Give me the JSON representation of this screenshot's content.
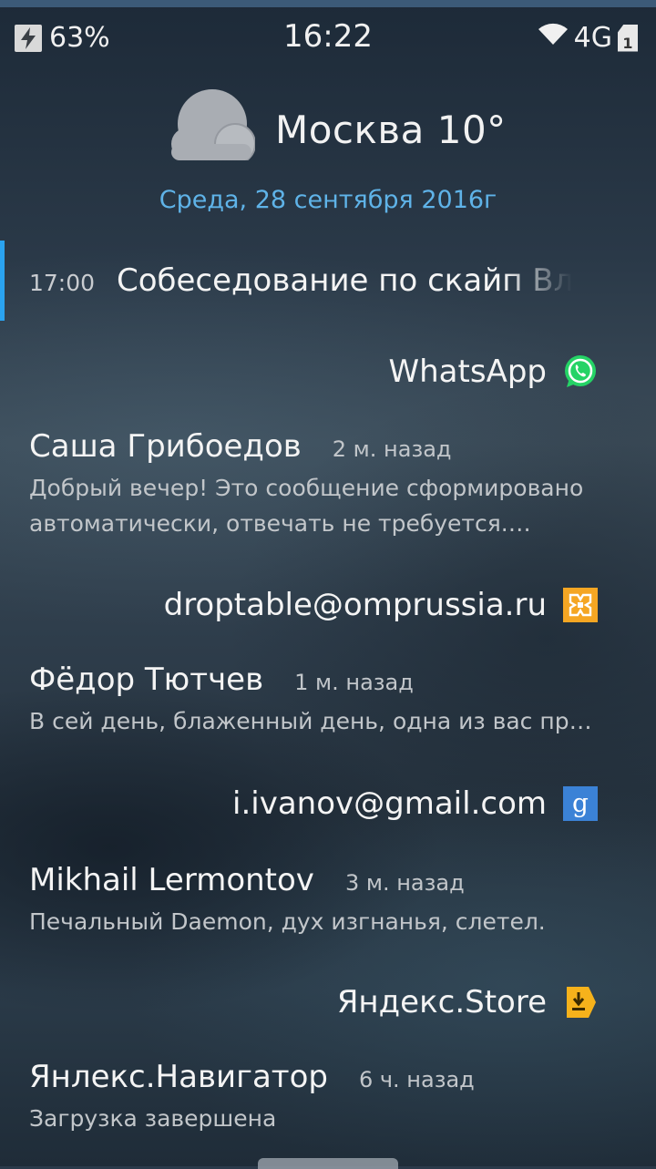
{
  "status_bar": {
    "battery": "63%",
    "time": "16:22",
    "network": "4G",
    "sim": "1"
  },
  "weather": {
    "icon": "cloud-icon",
    "text": "Москва 10°"
  },
  "date": "Среда, 28 сентября 2016г",
  "calendar_event": {
    "time": "17:00",
    "title": "Собеседование по скайп Вла"
  },
  "groups": [
    {
      "account": "WhatsApp",
      "icon": "whatsapp-icon",
      "color": "#25d366",
      "notification": {
        "sender": "Саша Грибоедов",
        "ago": "2 м. назад",
        "message": "Добрый вечер! Это сообщение сформировано автоматически, отвечать не требуется. Тестовое сообщение"
      }
    },
    {
      "account": "droptable@omprussia.ru",
      "icon": "mail-exchange-icon",
      "color": "#f5a623",
      "notification": {
        "sender": "Фёдор Тютчев",
        "ago": "1 м. назад",
        "message": "В сей день, блаженный день, одна из вас прияла"
      }
    },
    {
      "account": "i.ivanov@gmail.com",
      "icon": "google-icon",
      "color": "#3b82d6",
      "notification": {
        "sender": "Mikhail Lermontov",
        "ago": "3 м. назад",
        "message": "Печальный Daemon, дух изгнанья, слетел."
      }
    },
    {
      "account": "Яндекс.Store",
      "icon": "download-icon",
      "color": "#f6b21b",
      "notification": {
        "sender": "Янлекс.Навигатор",
        "ago": "6 ч. назад",
        "message": "Загрузка завершена"
      }
    }
  ]
}
